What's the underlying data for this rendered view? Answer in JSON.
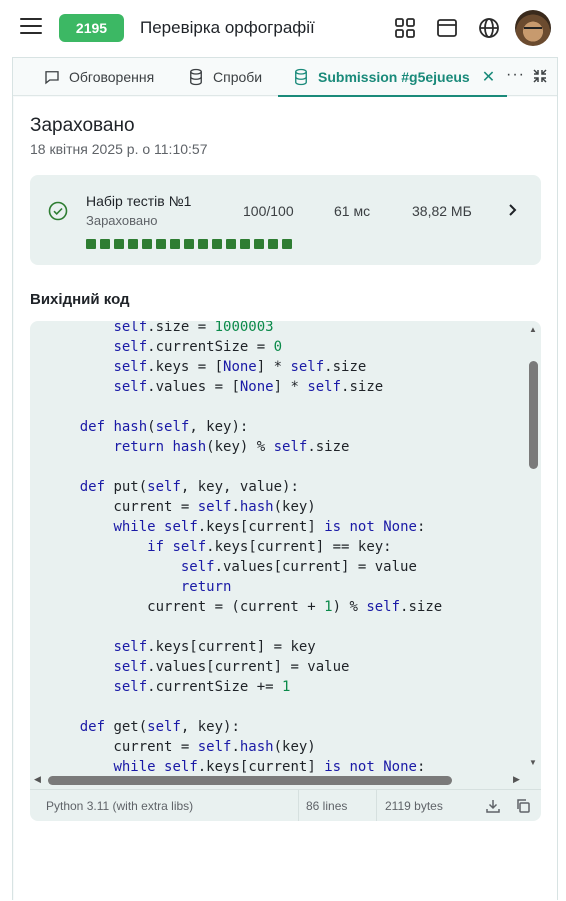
{
  "header": {
    "problem_id": "2195",
    "title": "Перевірка орфографії",
    "icons": [
      "menu-icon",
      "grid-icon",
      "window-icon",
      "globe-icon"
    ]
  },
  "tabs": [
    {
      "label": "Обговорення",
      "icon": "comment-icon"
    },
    {
      "label": "Спроби",
      "icon": "database-icon"
    },
    {
      "label": "Submission #g5ejueus",
      "icon": "database-icon",
      "active": true
    }
  ],
  "tab_close": "✕",
  "tab_more": "···",
  "status": {
    "title": "Зараховано",
    "date": "18 квітня 2025 р. о 11:10:57"
  },
  "testset": {
    "name": "Набір тестів №1",
    "status": "Зараховано",
    "score": "100/100",
    "time": "61 мс",
    "memory": "38,82 МБ",
    "passed_tests": 15,
    "color": "#2e7d32"
  },
  "source": {
    "title": "Вихідний код",
    "language": "Python 3.11 (with extra libs)",
    "lines": "86 lines",
    "bytes": "2119 bytes",
    "code_lines": [
      "        self.size = 1000003",
      "        self.currentSize = 0",
      "        self.keys = [None] * self.size",
      "        self.values = [None] * self.size",
      "",
      "    def hash(self, key):",
      "        return hash(key) % self.size",
      "",
      "    def put(self, key, value):",
      "        current = self.hash(key)",
      "        while self.keys[current] is not None:",
      "            if self.keys[current] == key:",
      "                self.values[current] = value",
      "                return",
      "            current = (current + 1) % self.size",
      "",
      "        self.keys[current] = key",
      "        self.values[current] = value",
      "        self.currentSize += 1",
      "",
      "    def get(self, key):",
      "        current = self.hash(key)",
      "        while self.keys[current] is not None:"
    ]
  },
  "colors": {
    "accent": "#1a8a7a",
    "badge": "#3cb864"
  }
}
